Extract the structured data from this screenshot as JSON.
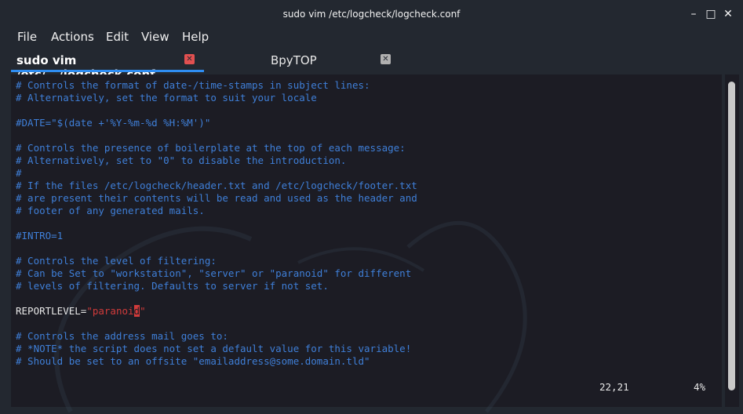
{
  "window": {
    "title": "sudo vim /etc/logcheck/logcheck.conf",
    "minimize_glyph": "–",
    "maximize_glyph": "□",
    "close_glyph": "✕"
  },
  "menu": {
    "items": [
      "File",
      "Actions",
      "Edit",
      "View",
      "Help"
    ]
  },
  "tabs": [
    {
      "label": "sudo vim /etc/.../logcheck.conf",
      "active": true,
      "close_color": "#e25050"
    },
    {
      "label": "BpyTOP",
      "active": false,
      "close_color": "#b0b0b0"
    }
  ],
  "editor": {
    "lines": [
      {
        "type": "comment",
        "text": "# Controls the format of date-/time-stamps in subject lines:"
      },
      {
        "type": "comment",
        "text": "# Alternatively, set the format to suit your locale"
      },
      {
        "type": "blank",
        "text": ""
      },
      {
        "type": "comment",
        "text": "#DATE=\"$(date +'%Y-%m-%d %H:%M')\""
      },
      {
        "type": "blank",
        "text": ""
      },
      {
        "type": "comment",
        "text": "# Controls the presence of boilerplate at the top of each message:"
      },
      {
        "type": "comment",
        "text": "# Alternatively, set to \"0\" to disable the introduction."
      },
      {
        "type": "comment",
        "text": "#"
      },
      {
        "type": "comment",
        "text": "# If the files /etc/logcheck/header.txt and /etc/logcheck/footer.txt"
      },
      {
        "type": "comment",
        "text": "# are present their contents will be read and used as the header and"
      },
      {
        "type": "comment",
        "text": "# footer of any generated mails."
      },
      {
        "type": "blank",
        "text": ""
      },
      {
        "type": "comment",
        "text": "#INTRO=1"
      },
      {
        "type": "blank",
        "text": ""
      },
      {
        "type": "comment",
        "text": "# Controls the level of filtering:"
      },
      {
        "type": "comment",
        "text": "# Can be Set to \"workstation\", \"server\" or \"paranoid\" for different"
      },
      {
        "type": "comment",
        "text": "# levels of filtering. Defaults to server if not set."
      },
      {
        "type": "blank",
        "text": ""
      },
      {
        "type": "assignment",
        "key": "REPORTLEVEL=",
        "value_before_cursor": "\"paranoi",
        "cursor_char": "d",
        "value_after_cursor": "\""
      },
      {
        "type": "blank",
        "text": ""
      },
      {
        "type": "comment",
        "text": "# Controls the address mail goes to:"
      },
      {
        "type": "comment",
        "text": "# *NOTE* the script does not set a default value for this variable!"
      },
      {
        "type": "comment",
        "text": "# Should be set to an offsite \"emailaddress@some.domain.tld\""
      }
    ],
    "cursor_position": "22,21",
    "scroll_percent": "4%"
  },
  "colors": {
    "comment": "#3f7fd8",
    "string": "#d23b3b",
    "tab_accent": "#2f8df2"
  }
}
